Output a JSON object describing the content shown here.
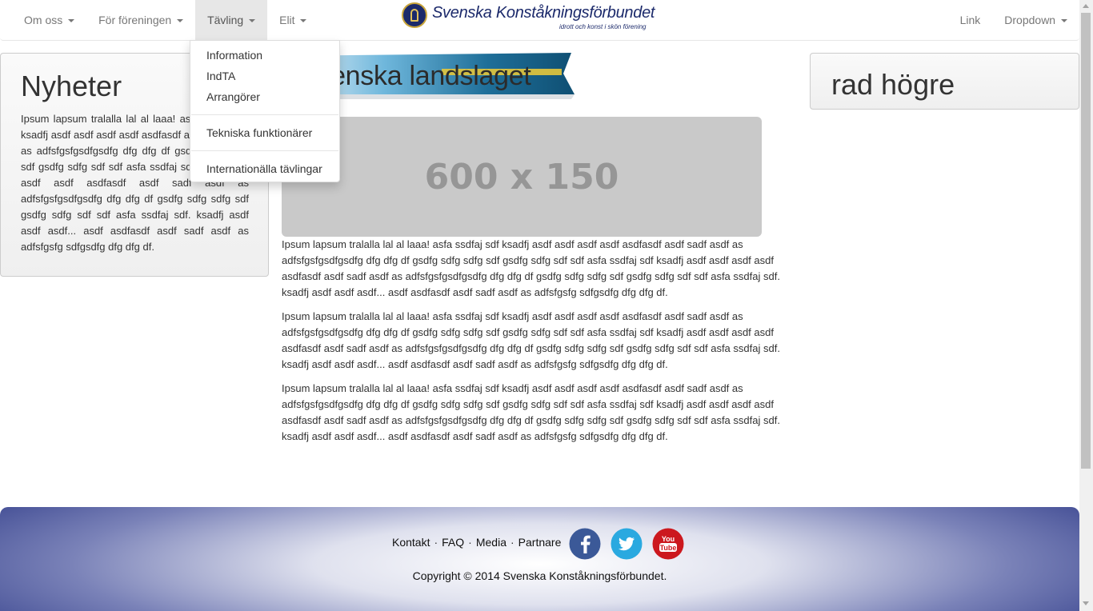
{
  "navbar": {
    "left_items": [
      {
        "label": "Om oss"
      },
      {
        "label": "För föreningen"
      },
      {
        "label": "Tävling"
      },
      {
        "label": "Elit"
      }
    ],
    "right_items": [
      {
        "label": "Link"
      },
      {
        "label": "Dropdown"
      }
    ],
    "brand": {
      "title": "Svenska Konståkningsförbundet",
      "tagline": "idrott och konst i skön förening",
      "color": "#1c2a6b"
    }
  },
  "dropdown": {
    "items": [
      {
        "label": "Information"
      },
      {
        "label": "IndTA"
      },
      {
        "label": "Arrangörer"
      },
      {
        "label": "Tekniska funktionärer"
      },
      {
        "label": "Internationälla tävlingar"
      }
    ]
  },
  "left_panel": {
    "title": "Nyheter",
    "text": "Ipsum lapsum tralalla lal al laaa! asfa ssdfaj sdf ksadfj asdf asdf asdf asdf asdfasdf asdf sadf asdf as adfsfgsfgsdfgsdfg dfg dfg df gsdfg sdfg sdfg sdf gsdfg sdfg sdf sdf asfa ssdfaj sdf ksadfj asdf asdf asdf asdfasdf asdf sadf asdf as adfsfgsfgsdfgsdfg dfg dfg df gsdfg sdfg sdfg sdf gsdfg sdfg sdf sdf asfa ssdfaj sdf. ksadfj asdf asdf asdf... asdf asdfasdf asdf sadf asdf as adfsfgsfg sdfgsdfg dfg dfg df."
  },
  "right_panel": {
    "title": "rad högre"
  },
  "banner": {
    "text": "Svenska landslaget"
  },
  "placeholder": {
    "label": "600 x 150"
  },
  "main": {
    "paragraphs": [
      "Ipsum lapsum tralalla lal al laaa! asfa ssdfaj sdf ksadfj asdf asdf asdf asdf asdfasdf asdf sadf asdf as adfsfgsfgsdfgsdfg dfg dfg df gsdfg sdfg sdfg sdf gsdfg sdfg sdf sdf asfa ssdfaj sdf ksadfj asdf asdf asdf asdf asdfasdf asdf sadf asdf as adfsfgsfgsdfgsdfg dfg dfg df gsdfg sdfg sdfg sdf gsdfg sdfg sdf sdf asfa ssdfaj sdf. ksadfj asdf asdf asdf... asdf asdfasdf asdf sadf asdf as adfsfgsfg sdfgsdfg dfg dfg df.",
      "Ipsum lapsum tralalla lal al laaa! asfa ssdfaj sdf ksadfj asdf asdf asdf asdf asdfasdf asdf sadf asdf as adfsfgsfgsdfgsdfg dfg dfg df gsdfg sdfg sdfg sdf gsdfg sdfg sdf sdf asfa ssdfaj sdf ksadfj asdf asdf asdf asdf asdfasdf asdf sadf asdf as adfsfgsfgsdfgsdfg dfg dfg df gsdfg sdfg sdfg sdf gsdfg sdfg sdf sdf asfa ssdfaj sdf. ksadfj asdf asdf asdf... asdf asdfasdf asdf sadf asdf as adfsfgsfg sdfgsdfg dfg dfg df.",
      "Ipsum lapsum tralalla lal al laaa! asfa ssdfaj sdf ksadfj asdf asdf asdf asdf asdfasdf asdf sadf asdf as adfsfgsfgsdfgsdfg dfg dfg df gsdfg sdfg sdfg sdf gsdfg sdfg sdf sdf asfa ssdfaj sdf ksadfj asdf asdf asdf asdf asdfasdf asdf sadf asdf as adfsfgsfgsdfgsdfg dfg dfg df gsdfg sdfg sdfg sdf gsdfg sdfg sdf sdf asfa ssdfaj sdf. ksadfj asdf asdf asdf... asdf asdfasdf asdf sadf asdf as adfsfgsfg sdfgsdfg dfg dfg df."
    ]
  },
  "footer": {
    "links": [
      {
        "label": "Kontakt"
      },
      {
        "label": "FAQ"
      },
      {
        "label": "Media"
      },
      {
        "label": "Partnare"
      }
    ],
    "separator": "·",
    "social": [
      {
        "icon": "facebook-icon",
        "color": "#3b5998"
      },
      {
        "icon": "twitter-icon",
        "color": "#2aa9e0"
      },
      {
        "icon": "youtube-icon",
        "color": "#cc181e"
      }
    ],
    "copyright": "Copyright © 2014 Svenska Konståkningsförbundet."
  }
}
